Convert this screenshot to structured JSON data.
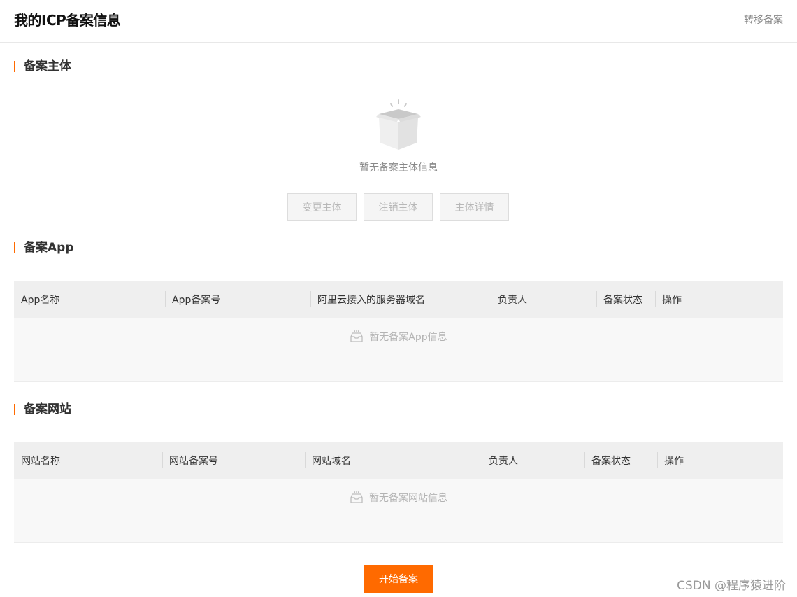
{
  "header": {
    "title": "我的ICP备案信息",
    "transfer_link": "转移备案"
  },
  "subject_section": {
    "title": "备案主体",
    "empty_text": "暂无备案主体信息",
    "buttons": [
      "变更主体",
      "注销主体",
      "主体详情"
    ]
  },
  "app_section": {
    "title": "备案App",
    "columns": [
      "App名称",
      "App备案号",
      "阿里云接入的服务器域名",
      "负责人",
      "备案状态",
      "操作"
    ],
    "empty_text": "暂无备案App信息"
  },
  "website_section": {
    "title": "备案网站",
    "columns": [
      "网站名称",
      "网站备案号",
      "网站域名",
      "负责人",
      "备案状态",
      "操作"
    ],
    "empty_text": "暂无备案网站信息"
  },
  "start_button": "开始备案",
  "watermark": "CSDN @程序猿进阶",
  "colors": {
    "accent": "#ff6a00"
  }
}
